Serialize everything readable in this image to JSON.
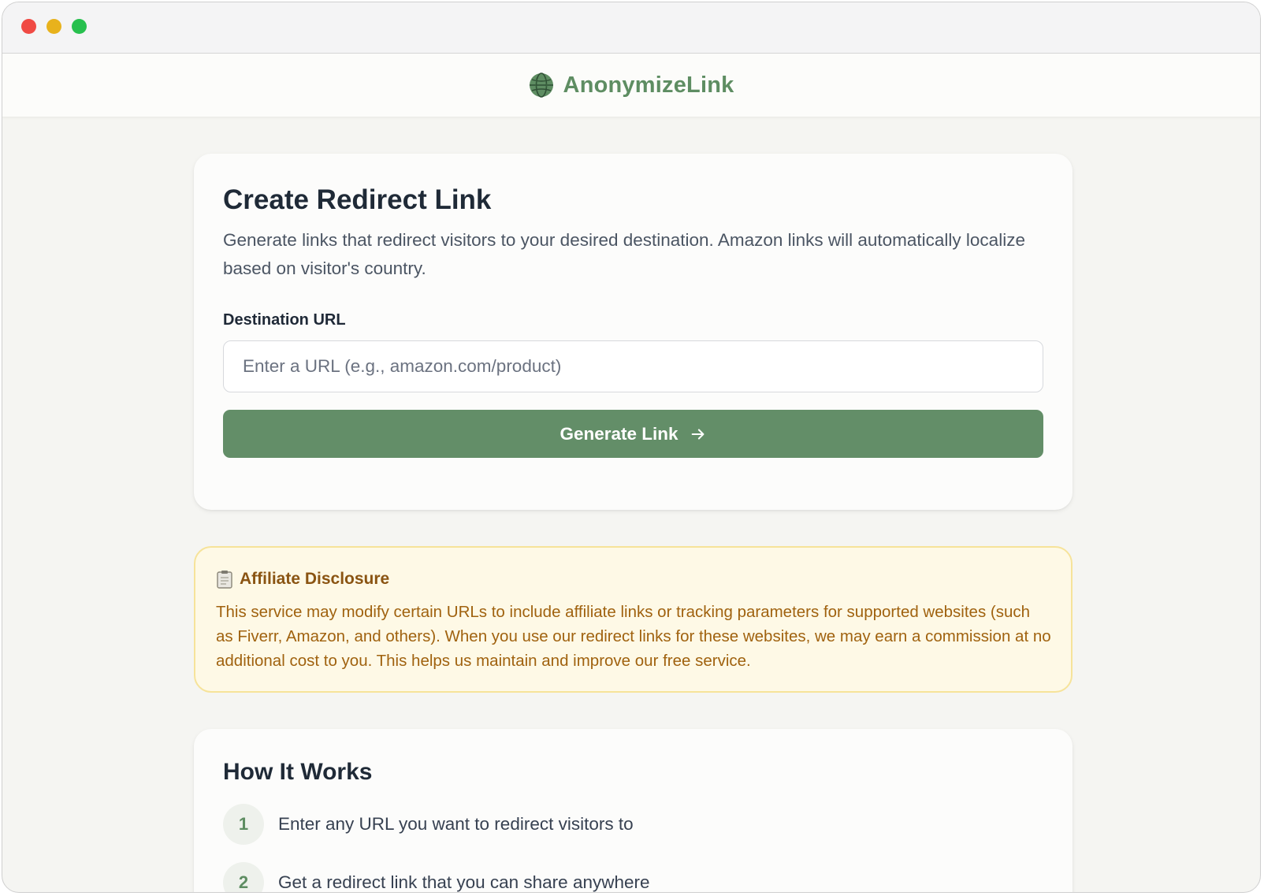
{
  "window": {
    "controls": [
      "close",
      "minimize",
      "maximize"
    ]
  },
  "header": {
    "brand_name": "AnonymizeLink",
    "logo_icon": "globe-icon"
  },
  "create_card": {
    "title": "Create Redirect Link",
    "description": "Generate links that redirect visitors to your desired destination. Amazon links will automatically localize based on visitor's country.",
    "field_label": "Destination URL",
    "input_value": "",
    "input_placeholder": "Enter a URL (e.g., amazon.com/product)",
    "button_label": "Generate Link",
    "button_icon": "arrow-right-icon"
  },
  "disclosure": {
    "icon": "clipboard-icon",
    "title": "Affiliate Disclosure",
    "text": "This service may modify certain URLs to include affiliate links or tracking parameters for supported websites (such as Fiverr, Amazon, and others). When you use our redirect links for these websites, we may earn a commission at no additional cost to you. This helps us maintain and improve our free service."
  },
  "how_it_works": {
    "title": "How It Works",
    "steps": [
      {
        "number": "1",
        "text": "Enter any URL you want to redirect visitors to"
      },
      {
        "number": "2",
        "text": "Get a redirect link that you can share anywhere"
      }
    ]
  },
  "colors": {
    "brand_green": "#5e8d62",
    "button_green": "#638e68",
    "disclosure_bg": "#fef9e6",
    "disclosure_border": "#f6e39a",
    "disclosure_text": "#a0620f"
  }
}
